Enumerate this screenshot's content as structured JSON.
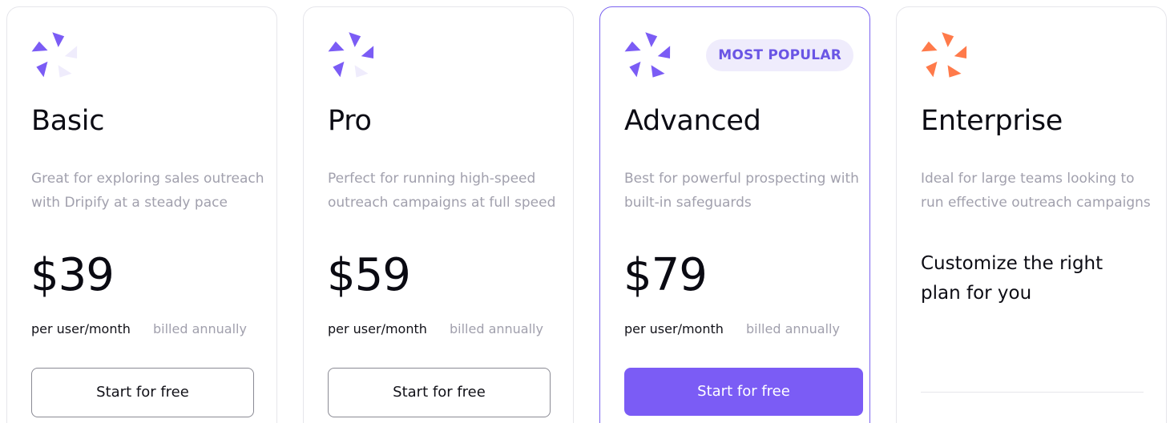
{
  "plans": [
    {
      "name": "Basic",
      "description": "Great for exploring sales outreach with Dripify at a steady pace",
      "price": "$39",
      "per_unit": "per user/month",
      "billing": "billed annually",
      "cta_label": "Start for free",
      "logo_icon": "dripify-logo-icon",
      "logo_color": "#7b5cf5"
    },
    {
      "name": "Pro",
      "description": "Perfect for running high-speed outreach campaigns at full speed",
      "price": "$59",
      "per_unit": "per user/month",
      "billing": "billed annually",
      "cta_label": "Start for free",
      "logo_icon": "dripify-logo-icon",
      "logo_color": "#7b5cf5"
    },
    {
      "name": "Advanced",
      "badge": "MOST POPULAR",
      "description": "Best for powerful prospecting with built-in safeguards",
      "price": "$79",
      "per_unit": "per user/month",
      "billing": "billed annually",
      "cta_label": "Start for free",
      "logo_icon": "dripify-logo-icon",
      "logo_color": "#7b5cf5"
    },
    {
      "name": "Enterprise",
      "description": "Ideal for large teams looking to run effective outreach campaigns",
      "custom_text": "Customize the right plan for you",
      "logo_icon": "dripify-logo-icon",
      "logo_color": "#ff7a4a"
    }
  ],
  "colors": {
    "accent": "#7b5cf5",
    "badge_bg": "#efecfc",
    "badge_text": "#6a55e5",
    "enterprise_accent": "#ff7a4a",
    "muted_text": "#a1a0ad",
    "border": "#e6e6eb"
  }
}
